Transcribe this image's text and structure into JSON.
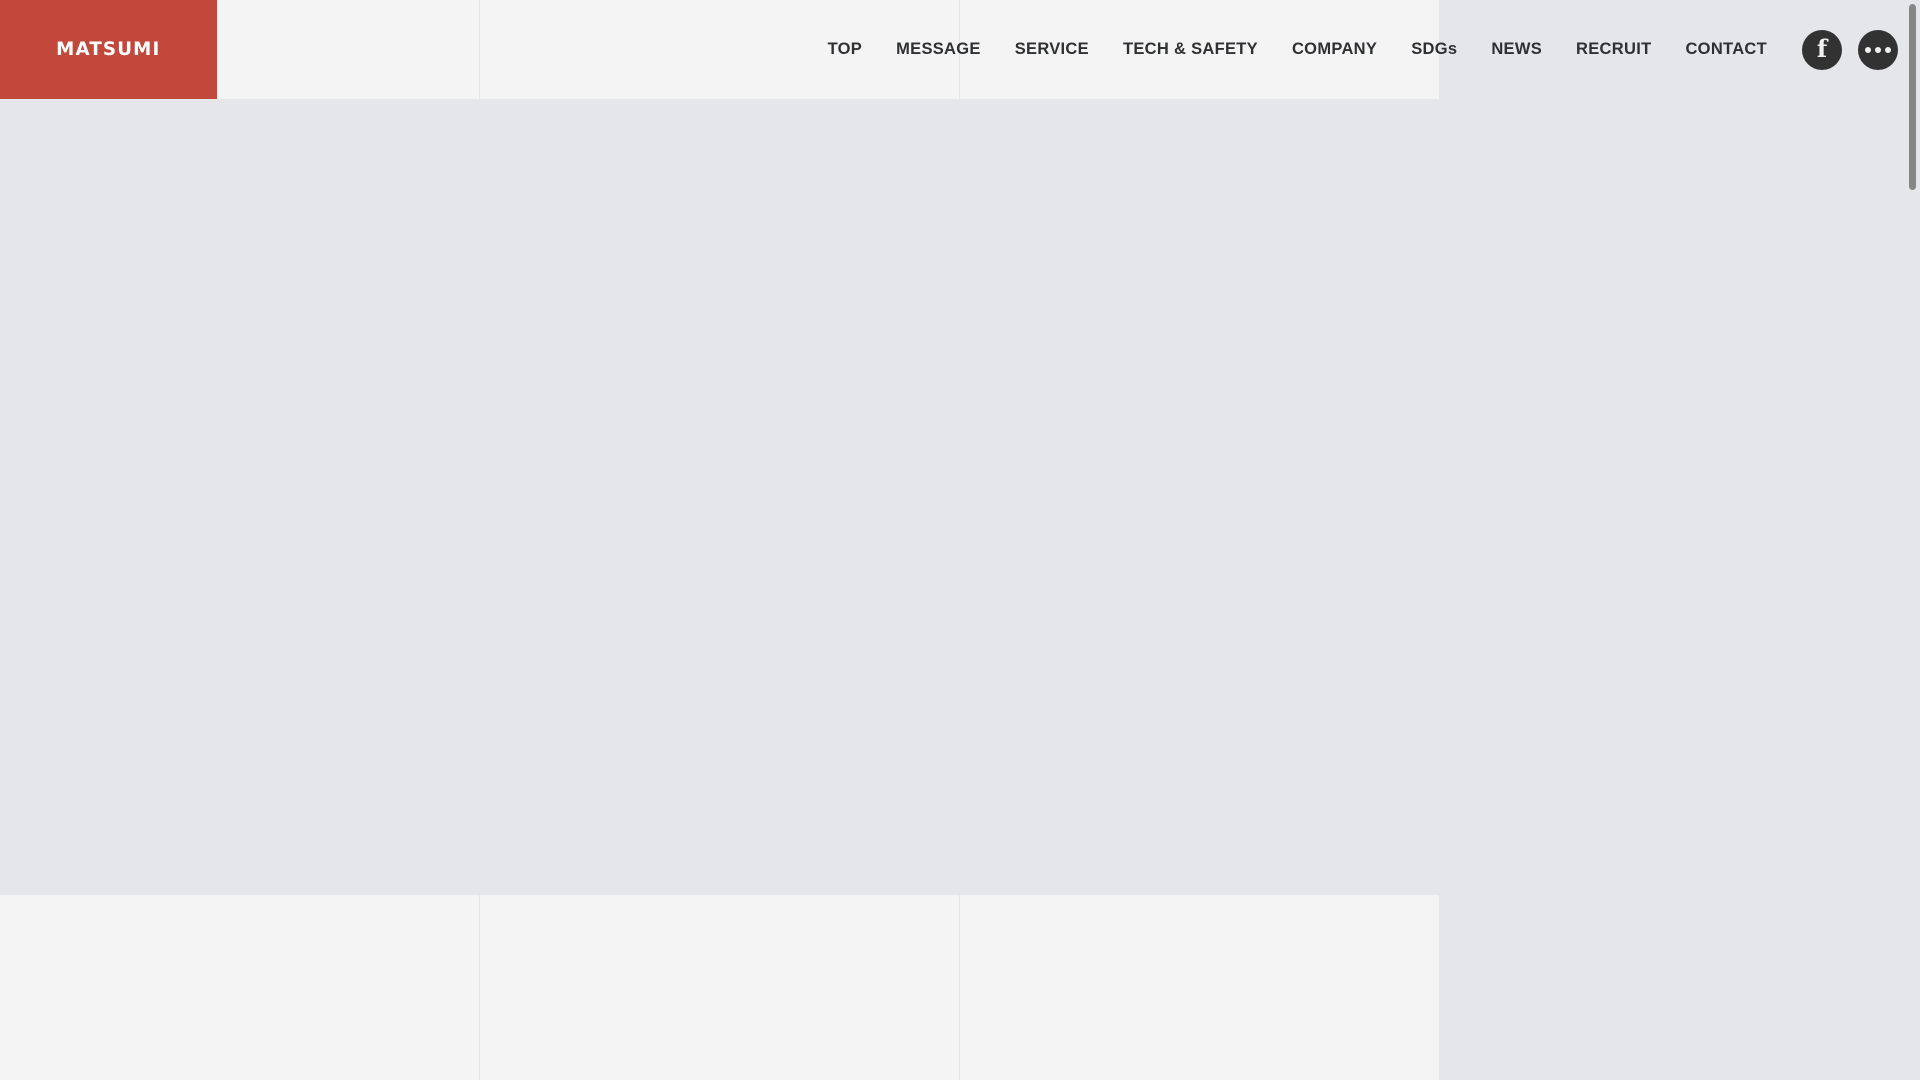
{
  "site": {
    "brand": "MATSUMI",
    "brand_color": "#c2483c",
    "header_bg": "#f4f4f5",
    "page_bg": "#e5e6ea",
    "text_color": "#2f3032",
    "icon_button_bg": "#323232"
  },
  "header": {
    "logo_label": "MATSUMI",
    "nav": [
      {
        "label": "TOP",
        "name": "nav-item-top"
      },
      {
        "label": "MESSAGE",
        "name": "nav-item-message"
      },
      {
        "label": "SERVICE",
        "name": "nav-item-service"
      },
      {
        "label": "TECH & SAFETY",
        "name": "nav-item-tech-safety"
      },
      {
        "label": "COMPANY",
        "name": "nav-item-company"
      },
      {
        "label": "SDGs",
        "name": "nav-item-sdgs"
      },
      {
        "label": "NEWS",
        "name": "nav-item-news"
      },
      {
        "label": "RECRUIT",
        "name": "nav-item-recruit"
      },
      {
        "label": "CONTACT",
        "name": "nav-item-contact"
      }
    ],
    "icons": [
      {
        "name": "facebook-icon",
        "glyph": "f"
      },
      {
        "name": "more-menu-icon",
        "glyph": "···"
      }
    ]
  },
  "main": {
    "content": ""
  },
  "lower_panel": {
    "cells": [
      "",
      "",
      ""
    ]
  },
  "scrollbar": {
    "thumb_color": "#868686",
    "position": "top"
  }
}
